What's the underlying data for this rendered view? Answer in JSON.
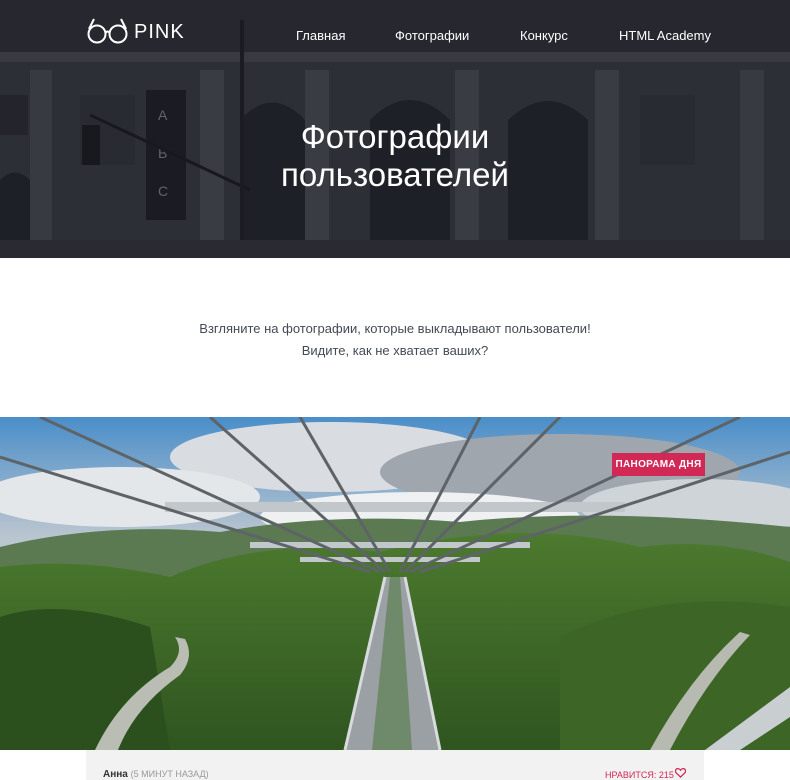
{
  "header": {
    "logo_text": "PINK",
    "nav": [
      "Главная",
      "Фотографии",
      "Конкурс",
      "HTML Academy"
    ]
  },
  "hero": {
    "title_line1": "Фотографии",
    "title_line2": "пользователей"
  },
  "intro": {
    "line1": "Взгляните на фотографии, которые выкладывают пользователи!",
    "line2": "Видите, как не хватает ваших?"
  },
  "photo": {
    "badge": "ПАНОРАМА ДНЯ"
  },
  "post": {
    "author": "Анна",
    "time": "(5 МИНУТ НАЗАД)",
    "likes": "НРАВИТСЯ: 215"
  },
  "colors": {
    "accent": "#d22856",
    "hero_bg": "#2b2d36"
  }
}
